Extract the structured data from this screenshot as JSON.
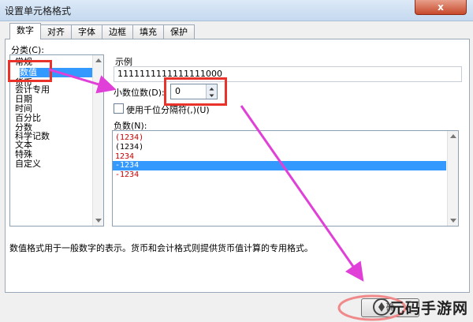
{
  "window": {
    "title": "设置单元格格式",
    "close_label": "x"
  },
  "tabs": [
    {
      "label": "数字",
      "active": true
    },
    {
      "label": "对齐"
    },
    {
      "label": "字体"
    },
    {
      "label": "边框"
    },
    {
      "label": "填充"
    },
    {
      "label": "保护"
    }
  ],
  "category": {
    "label": "分类(C):",
    "items": [
      "常规",
      "数值",
      "货币",
      "会计专用",
      "日期",
      "时间",
      "百分比",
      "分数",
      "科学记数",
      "文本",
      "特殊",
      "自定义"
    ],
    "selected": "数值"
  },
  "sample": {
    "label": "示例",
    "value": "1111111111111111000"
  },
  "decimal": {
    "label": "小数位数(D):",
    "value": "0"
  },
  "thousands": {
    "label": "使用千位分隔符(,)(U)",
    "checked": false
  },
  "negative": {
    "label": "负数(N):",
    "items": [
      {
        "text": "(1234)",
        "color": "#cc0000"
      },
      {
        "text": "(1234)",
        "color": "#000000"
      },
      {
        "text": "1234",
        "color": "#cc0000"
      },
      {
        "text": "-1234",
        "color": "#000000",
        "selected": true
      },
      {
        "text": "-1234",
        "color": "#cc0000"
      }
    ]
  },
  "description": "数值格式用于一般数字的表示。货币和会计格式则提供货币值计算的专用格式。",
  "buttons": {
    "ok_label": "确"
  },
  "watermark": {
    "text": "元码手游网"
  },
  "colors": {
    "highlight": "#e8322a",
    "arrow": "#e040d8",
    "selection": "#3399ff"
  }
}
